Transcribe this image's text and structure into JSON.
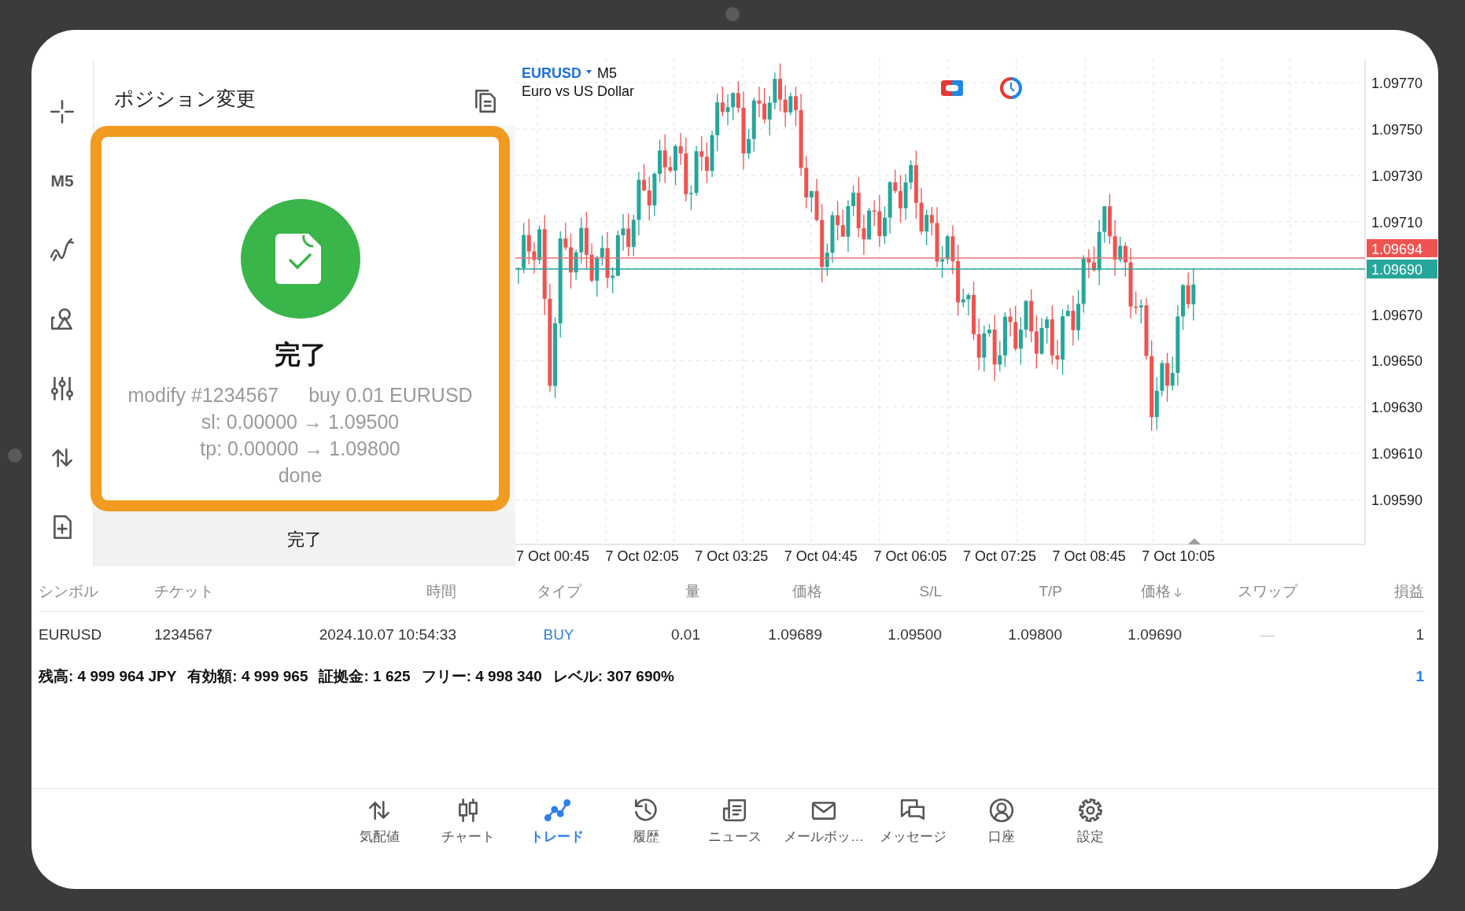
{
  "left_toolbar": [
    {
      "kind": "crosshair"
    },
    {
      "kind": "timeframe",
      "label": "M5"
    },
    {
      "kind": "indicators"
    },
    {
      "kind": "objects"
    },
    {
      "kind": "settings"
    },
    {
      "kind": "trade"
    },
    {
      "kind": "new-order"
    }
  ],
  "dialog": {
    "title": "ポジション変更",
    "status": "完了",
    "details": [
      {
        "parts": [
          "modify #1234567",
          "buy 0.01 EURUSD"
        ]
      },
      {
        "parts": [
          "sl: 0.00000 → 1.09500"
        ]
      },
      {
        "parts": [
          "tp: 0.00000 → 1.09800"
        ]
      },
      {
        "parts": [
          "done"
        ]
      }
    ],
    "button": "完了"
  },
  "chart": {
    "symbol": "EURUSD",
    "timeframe": "M5",
    "description": "Euro vs US Dollar",
    "price_ticks": [
      "1.09770",
      "1.09750",
      "1.09730",
      "1.09710",
      "1.09670",
      "1.09650",
      "1.09630",
      "1.09610",
      "1.09590"
    ],
    "ask_tag": "1.09694",
    "bid_tag": "1.09690",
    "time_labels": [
      "7 Oct 00:45",
      "7 Oct 02:05",
      "7 Oct 03:25",
      "7 Oct 04:45",
      "7 Oct 06:05",
      "7 Oct 07:25",
      "7 Oct 08:45",
      "7 Oct 10:05"
    ]
  },
  "table": {
    "columns": [
      {
        "kind": "symbol",
        "label": "シンボル",
        "sorted": false
      },
      {
        "kind": "ticket",
        "label": "チケット",
        "sorted": false
      },
      {
        "kind": "time",
        "label": "時間",
        "sorted": false
      },
      {
        "kind": "type",
        "label": "タイプ",
        "sorted": false
      },
      {
        "kind": "volume",
        "label": "量",
        "sorted": false
      },
      {
        "kind": "price",
        "label": "価格",
        "sorted": false
      },
      {
        "kind": "sl",
        "label": "S/L",
        "sorted": false
      },
      {
        "kind": "tp",
        "label": "T/P",
        "sorted": false
      },
      {
        "kind": "price",
        "label": "価格",
        "sorted": true
      },
      {
        "kind": "swap",
        "label": "スワップ",
        "sorted": false
      },
      {
        "kind": "profit",
        "label": "損益",
        "sorted": false
      }
    ],
    "rows": [
      {
        "cells": [
          "EURUSD",
          "1234567",
          "2024.10.07 10:54:33",
          "BUY",
          "0.01",
          "1.09689",
          "1.09500",
          "1.09800",
          "1.09690",
          "—",
          "1"
        ]
      }
    ]
  },
  "summary": {
    "items": [
      "残高: 4 999 964 JPY",
      "有効額: 4 999 965",
      "証拠金: 1 625",
      "フリー: 4 998 340",
      "レベル: 307 690%"
    ],
    "total": "1"
  },
  "bottom_nav": [
    {
      "kind": "quotes",
      "label": "気配値",
      "selected": false
    },
    {
      "kind": "chart",
      "label": "チャート",
      "selected": false
    },
    {
      "kind": "trade",
      "label": "トレード",
      "selected": true
    },
    {
      "kind": "history",
      "label": "履歴",
      "selected": false
    },
    {
      "kind": "news",
      "label": "ニュース",
      "selected": false
    },
    {
      "kind": "mailbox",
      "label": "メールボッ…",
      "selected": false
    },
    {
      "kind": "messages",
      "label": "メッセージ",
      "selected": false
    },
    {
      "kind": "accounts",
      "label": "口座",
      "selected": false
    },
    {
      "kind": "settings",
      "label": "設定",
      "selected": false
    }
  ]
}
